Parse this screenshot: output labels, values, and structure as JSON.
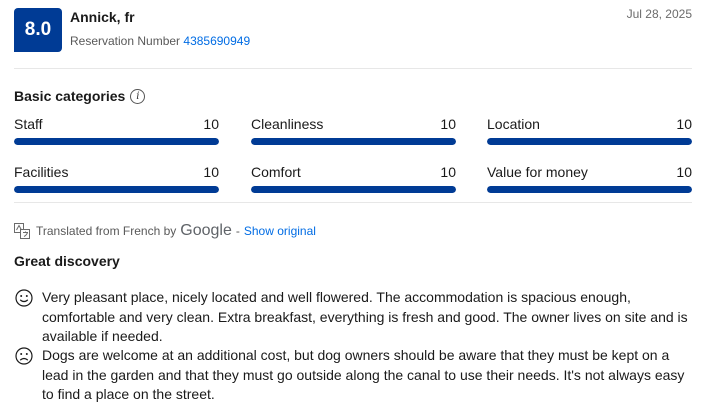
{
  "review": {
    "score": "8.0",
    "reviewer": "Annick, fr",
    "reservation_label": "Reservation Number",
    "reservation_number": "4385690949",
    "date": "Jul 28, 2025"
  },
  "categories": {
    "title": "Basic categories",
    "items": [
      {
        "label": "Staff",
        "value": "10",
        "fill": 1.0
      },
      {
        "label": "Cleanliness",
        "value": "10",
        "fill": 1.0
      },
      {
        "label": "Location",
        "value": "10",
        "fill": 1.0
      },
      {
        "label": "Facilities",
        "value": "10",
        "fill": 1.0
      },
      {
        "label": "Comfort",
        "value": "10",
        "fill": 1.0
      },
      {
        "label": "Value for money",
        "value": "10",
        "fill": 1.0
      }
    ]
  },
  "translation": {
    "prefix": "Translated from French by",
    "provider": "Google",
    "separator": "-",
    "show_original": "Show original"
  },
  "body": {
    "title": "Great discovery",
    "positive": "Very pleasant place, nicely located and well flowered. The accommodation is spacious enough, comfortable and very clean. Extra breakfast, everything is fresh and good. The owner lives on site and is available if needed.",
    "negative": "Dogs are welcome at an additional cost, but dog owners should be aware that they must be kept on a lead in the garden and that they must go outside along the canal to use their needs. It's not always easy to find a place on the street."
  },
  "colors": {
    "brand": "#003b95",
    "link": "#006ce4"
  }
}
